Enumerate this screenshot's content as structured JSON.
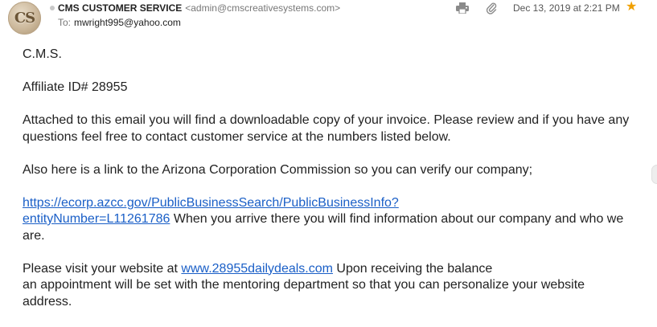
{
  "header": {
    "avatar_initials": "CS",
    "sender_name": "CMS CUSTOMER SERVICE",
    "sender_email": "<admin@cmscreativesystems.com>",
    "to_label": "To:",
    "to_address": "mwright995@yahoo.com",
    "date": "Dec 13, 2019 at 2:21 PM",
    "icons": [
      "print-icon",
      "attachment-icon",
      "star-icon"
    ],
    "star_color": "#f0a000"
  },
  "body": {
    "greeting": "C.M.S.",
    "affiliate": "Affiliate ID# 28955",
    "paragraph1": "Attached to this email you will find a downloadable copy of your invoice. Please review and if you have any questions feel free to contact customer service at the numbers listed below.",
    "paragraph2": "Also here is a link to the Arizona Corporation Commission so you can verify our company;",
    "link1_part1": "https://ecorp.azcc.gov/PublicBusinessSearch/PublicBusinessInfo?",
    "link1_part2": "entityNumber=L11261786",
    "paragraph3_rest": " When you arrive there you will find information about our company and who we are.",
    "paragraph4_start": "Please visit your website at ",
    "link2": "www.28955dailydeals.com",
    "paragraph4_line1_rest": " Upon receiving the balance",
    "paragraph4_rest": "an appointment will be set with the mentoring department so that you can personalize your website address.",
    "link_color": "#1a5fc7"
  }
}
